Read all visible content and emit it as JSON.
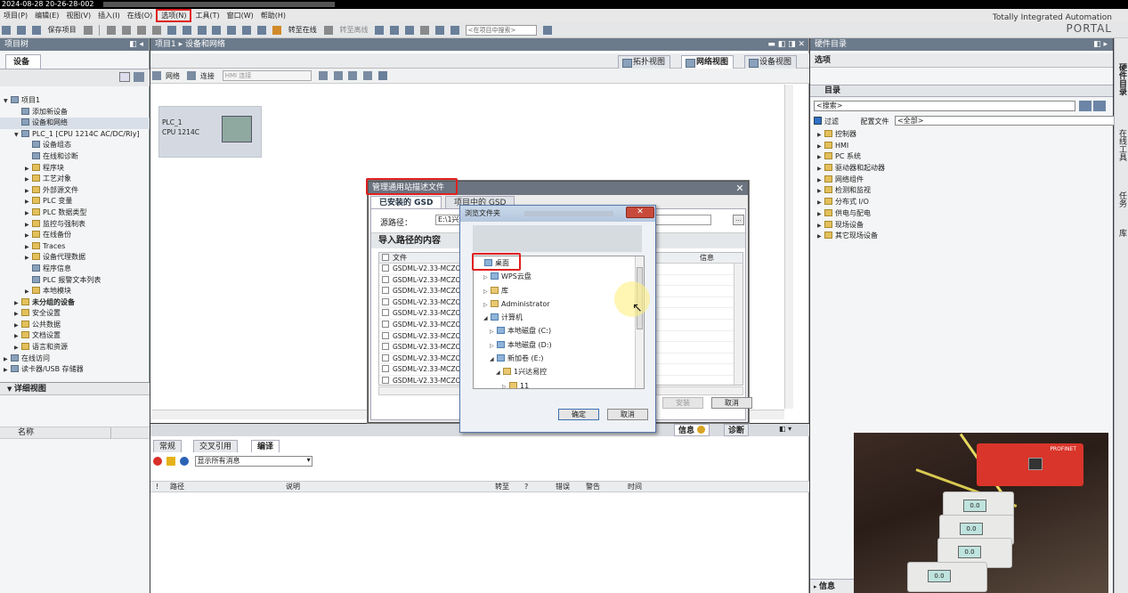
{
  "window": {
    "timestamp": "2024-08-28 20-26-28-002"
  },
  "menu": {
    "items": [
      "项目(P)",
      "编辑(E)",
      "视图(V)",
      "插入(I)",
      "在线(O)",
      "选项(N)",
      "工具(T)",
      "窗口(W)",
      "帮助(H)"
    ]
  },
  "toolbar": {
    "save": "保存项目",
    "go_online": "转至在线",
    "go_offline": "转至离线",
    "search_placeholder": "<在项目中搜索>"
  },
  "brand": {
    "line1": "Totally Integrated Automation",
    "line2": "PORTAL"
  },
  "left": {
    "header": "项目树",
    "tab": "设备",
    "tree": [
      {
        "label": "项目1",
        "lvl": 0,
        "tg": "▼"
      },
      {
        "label": "添加新设备",
        "lvl": 1,
        "tg": ""
      },
      {
        "label": "设备和网络",
        "lvl": 1,
        "tg": "",
        "sel": true
      },
      {
        "label": "PLC_1 [CPU 1214C AC/DC/Rly]",
        "lvl": 1,
        "tg": "▼"
      },
      {
        "label": "设备组态",
        "lvl": 2,
        "tg": ""
      },
      {
        "label": "在线和诊断",
        "lvl": 2,
        "tg": ""
      },
      {
        "label": "程序块",
        "lvl": 2,
        "tg": "▶",
        "y": true
      },
      {
        "label": "工艺对象",
        "lvl": 2,
        "tg": "▶",
        "y": true
      },
      {
        "label": "外部源文件",
        "lvl": 2,
        "tg": "▶",
        "y": true
      },
      {
        "label": "PLC 变量",
        "lvl": 2,
        "tg": "▶",
        "y": true
      },
      {
        "label": "PLC 数据类型",
        "lvl": 2,
        "tg": "▶",
        "y": true
      },
      {
        "label": "监控与强制表",
        "lvl": 2,
        "tg": "▶",
        "y": true
      },
      {
        "label": "在线备份",
        "lvl": 2,
        "tg": "▶",
        "y": true
      },
      {
        "label": "Traces",
        "lvl": 2,
        "tg": "▶",
        "y": true
      },
      {
        "label": "设备代理数据",
        "lvl": 2,
        "tg": "▶",
        "y": true
      },
      {
        "label": "程序信息",
        "lvl": 2,
        "tg": ""
      },
      {
        "label": "PLC 报警文本列表",
        "lvl": 2,
        "tg": ""
      },
      {
        "label": "本地模块",
        "lvl": 2,
        "tg": "▶",
        "y": true
      },
      {
        "label": "未分组的设备",
        "lvl": 1,
        "tg": "▶",
        "b": true,
        "y": true
      },
      {
        "label": "安全设置",
        "lvl": 1,
        "tg": "▶",
        "y": true
      },
      {
        "label": "公共数据",
        "lvl": 1,
        "tg": "▶",
        "y": true
      },
      {
        "label": "文档设置",
        "lvl": 1,
        "tg": "▶",
        "y": true
      },
      {
        "label": "语言和资源",
        "lvl": 1,
        "tg": "▶",
        "y": true
      },
      {
        "label": "在线访问",
        "lvl": 0,
        "tg": "▶"
      },
      {
        "label": "读卡器/USB 存储器",
        "lvl": 0,
        "tg": "▶"
      }
    ],
    "detail_header": "详细视图",
    "detail_col": "名称"
  },
  "center": {
    "breadcrumb": "项目1 ▸ 设备和网络",
    "views": [
      "拓扑视图",
      "网络视图",
      "设备视图"
    ],
    "bar": {
      "network": "网络",
      "connect": "连接",
      "hmi_select": "HMI 连接"
    },
    "plc": {
      "name": "PLC_1",
      "cpu": "CPU 1214C"
    }
  },
  "bottom": {
    "tabs_right": [
      "信息",
      "诊断"
    ],
    "tabs": [
      "常规",
      "交叉引用",
      "编译"
    ],
    "filter": "显示所有消息",
    "cols": [
      "路径",
      "说明",
      "转至",
      "?",
      "错误",
      "警告",
      "时间"
    ]
  },
  "right": {
    "header": "硬件目录",
    "options": "选项",
    "catalog": "目录",
    "search": "<搜索>",
    "filter": "过滤",
    "profile_label": "配置文件",
    "profile": "<全部>",
    "tree": [
      "控制器",
      "HMI",
      "PC 系统",
      "驱动器和起动器",
      "网络组件",
      "检测和监视",
      "分布式 I/O",
      "供电与配电",
      "现场设备",
      "其它现场设备"
    ],
    "info": "信息",
    "side_tabs": [
      "硬件目录",
      "在线工具",
      "任务",
      "库"
    ]
  },
  "gsd": {
    "title": "管理通用站描述文件",
    "tabs": [
      "已安装的 GSD",
      "项目中的 GSD"
    ],
    "source_label": "源路径：",
    "source": "E:\\1兴达",
    "import_header": "导入路径的内容",
    "col_file": "文件",
    "col_info": "信息",
    "files": [
      "GSDML-V2.33-MCZOTE",
      "GSDML-V2.33-MCZOTE",
      "GSDML-V2.33-MCZOTE",
      "GSDML-V2.33-MCZOTE",
      "GSDML-V2.33-MCZOTE",
      "GSDML-V2.33-MCZOTE",
      "GSDML-V2.33-MCZOTE",
      "GSDML-V2.33-MCZOTE",
      "GSDML-V2.33-MCZOTE",
      "GSDML-V2.33-MCZOTE",
      "GSDML-V2.33-MCZOTE"
    ],
    "install": "安装",
    "cancel": "取消"
  },
  "browse": {
    "title": "浏览文件夹",
    "tree": [
      {
        "label": "桌面",
        "lvl": 0,
        "tg": "",
        "hl": true
      },
      {
        "label": "WPS云盘",
        "lvl": 1,
        "tg": "▷"
      },
      {
        "label": "库",
        "lvl": 1,
        "tg": "▷",
        "y": true
      },
      {
        "label": "Administrator",
        "lvl": 1,
        "tg": "▷",
        "y": true
      },
      {
        "label": "计算机",
        "lvl": 1,
        "tg": "◢"
      },
      {
        "label": "本地磁盘 (C:)",
        "lvl": 2,
        "tg": "▷"
      },
      {
        "label": "本地磁盘 (D:)",
        "lvl": 2,
        "tg": "▷"
      },
      {
        "label": "新加卷 (E:)",
        "lvl": 2,
        "tg": "◢"
      },
      {
        "label": "1兴达易控",
        "lvl": 3,
        "tg": "◢",
        "y": true
      },
      {
        "label": "11",
        "lvl": 4,
        "tg": "▷",
        "y": true
      }
    ],
    "ok": "确定",
    "cancel": "取消"
  },
  "photo": {
    "brand_label": "PROFINET",
    "reading": "0.0"
  }
}
